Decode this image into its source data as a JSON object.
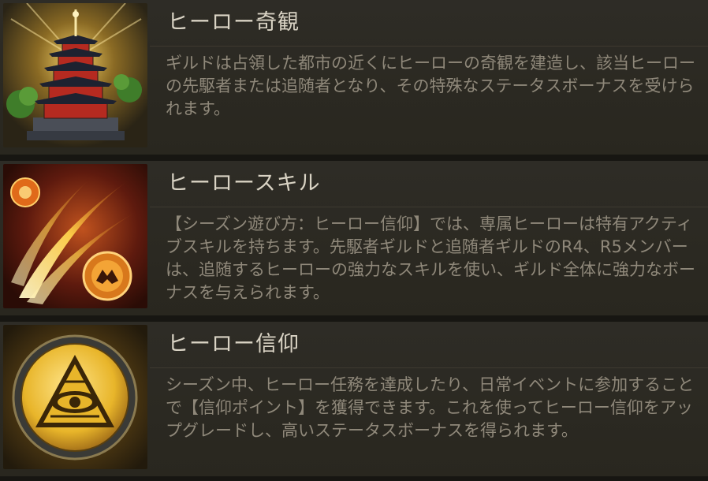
{
  "cards": [
    {
      "title": "ヒーロー奇観",
      "description": "ギルドは占領した都市の近くにヒーローの奇観を建造し、該当ヒーローの先駆者または追随者となり、その特殊なステータスボーナスを受けられます。",
      "icon": "pagoda-tower-icon"
    },
    {
      "title": "ヒーロースキル",
      "description": "【シーズン遊び方：ヒーロー信仰】では、専属ヒーローは特有アクティブスキルを持ちます。先駆者ギルドと追随者ギルドのR4、R5メンバーは、追随するヒーローの強力なスキルを使い、ギルド全体に強力なボーナスを与えられます。",
      "icon": "fire-skill-orbs-icon"
    },
    {
      "title": "ヒーロー信仰",
      "description": "シーズン中、ヒーロー任務を達成したり、日常イベントに参加することで【信仰ポイント】を獲得できます。これを使ってヒーロー信仰をアップグレードし、高いステータスボーナスを得られます。",
      "icon": "eye-pyramid-medal-icon"
    }
  ]
}
